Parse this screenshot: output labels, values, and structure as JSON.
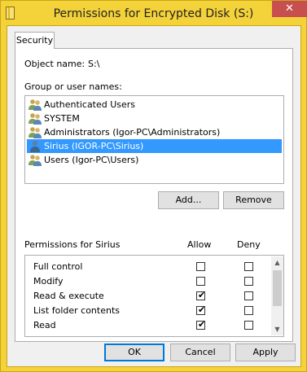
{
  "window": {
    "title": "Permissions for Encrypted Disk (S:)",
    "close_glyph": "✕"
  },
  "tabs": [
    {
      "label": "Security"
    }
  ],
  "object": {
    "label": "Object name:",
    "value": "S:\\"
  },
  "groups": {
    "label": "Group or user names:",
    "items": [
      {
        "name": "Authenticated Users",
        "icon": "users-group-icon",
        "selected": false
      },
      {
        "name": "SYSTEM",
        "icon": "users-group-icon",
        "selected": false
      },
      {
        "name": "Administrators (Igor-PC\\Administrators)",
        "icon": "users-group-icon",
        "selected": false
      },
      {
        "name": "Sirius (IGOR-PC\\Sirius)",
        "icon": "user-icon",
        "selected": true
      },
      {
        "name": "Users (Igor-PC\\Users)",
        "icon": "users-group-icon",
        "selected": false
      }
    ],
    "selection_color": "#3399ff"
  },
  "buttons": {
    "add": "Add...",
    "remove": "Remove",
    "ok": "OK",
    "cancel": "Cancel",
    "apply": "Apply"
  },
  "permissions": {
    "header": "Permissions for Sirius",
    "allow_header": "Allow",
    "deny_header": "Deny",
    "check_glyph": "✔",
    "rows": [
      {
        "name": "Full control",
        "allow": false,
        "deny": false
      },
      {
        "name": "Modify",
        "allow": false,
        "deny": false
      },
      {
        "name": "Read & execute",
        "allow": true,
        "deny": false
      },
      {
        "name": "List folder contents",
        "allow": true,
        "deny": false
      },
      {
        "name": "Read",
        "allow": true,
        "deny": false
      }
    ]
  },
  "scrollbar": {
    "up_glyph": "▲",
    "down_glyph": "▼"
  }
}
